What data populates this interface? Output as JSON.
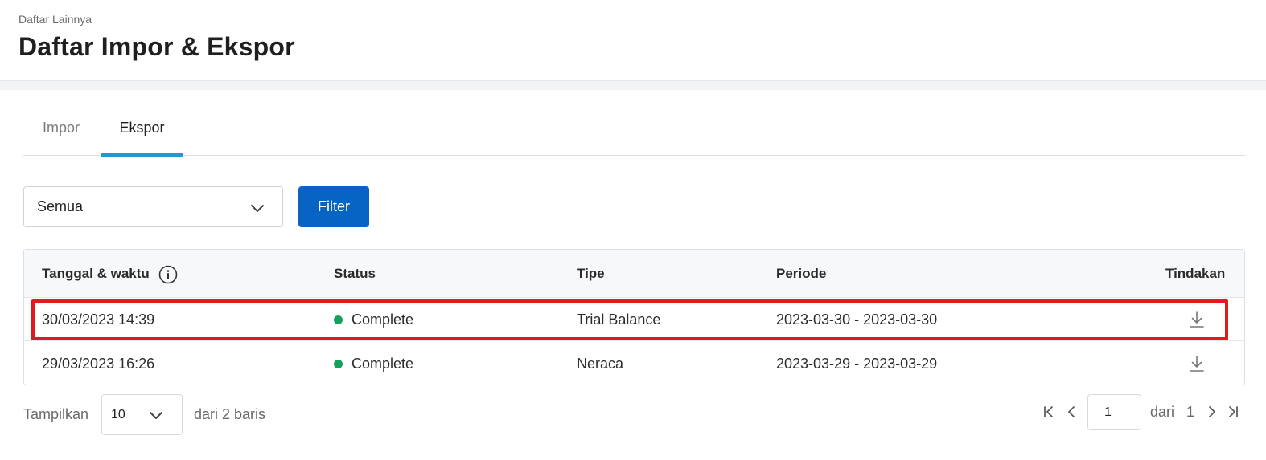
{
  "header": {
    "breadcrumb": "Daftar Lainnya",
    "title": "Daftar Impor & Ekspor"
  },
  "tabs": [
    {
      "label": "Impor",
      "active": false
    },
    {
      "label": "Ekspor",
      "active": true
    }
  ],
  "filter": {
    "selected": "Semua",
    "button_label": "Filter"
  },
  "table": {
    "columns": [
      "Tanggal & waktu",
      "Status",
      "Tipe",
      "Periode",
      "Tindakan"
    ],
    "rows": [
      {
        "datetime": "30/03/2023 14:39",
        "status": "Complete",
        "type": "Trial Balance",
        "period": "2023-03-30 - 2023-03-30",
        "highlighted": true
      },
      {
        "datetime": "29/03/2023 16:26",
        "status": "Complete",
        "type": "Neraca",
        "period": "2023-03-29 - 2023-03-29",
        "highlighted": false
      }
    ]
  },
  "pagination": {
    "show_label": "Tampilkan",
    "page_size": "10",
    "rows_summary": "dari 2 baris",
    "current_page": "1",
    "of_label": "dari",
    "total_pages": "1"
  },
  "colors": {
    "accent_tab": "#1a9ad9",
    "primary_button": "#0764c4",
    "status_complete": "#16a05d",
    "highlight": "#e11a22"
  }
}
